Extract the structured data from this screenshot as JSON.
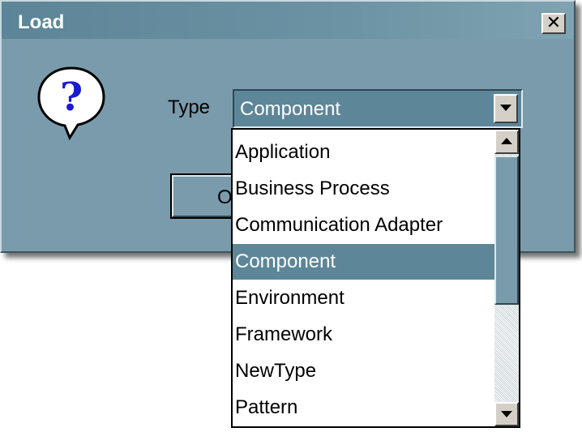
{
  "dialog": {
    "title": "Load",
    "close_label": "✕",
    "ok_label": "OK"
  },
  "type_field": {
    "label": "Type",
    "value": "Component"
  },
  "dropdown": {
    "items": [
      "Application",
      "Business Process",
      "Communication Adapter",
      "Component",
      "Environment",
      "Framework",
      "NewType",
      "Pattern"
    ],
    "selected_index": 3
  },
  "icons": {
    "dialog": "question-icon",
    "combo_arrow": "chevron-down-icon",
    "scroll_up": "scroll-up-arrow-icon",
    "scroll_down": "scroll-down-arrow-icon"
  },
  "colors": {
    "accent": "#5e8699",
    "dialog_background": "#7a9bab"
  }
}
